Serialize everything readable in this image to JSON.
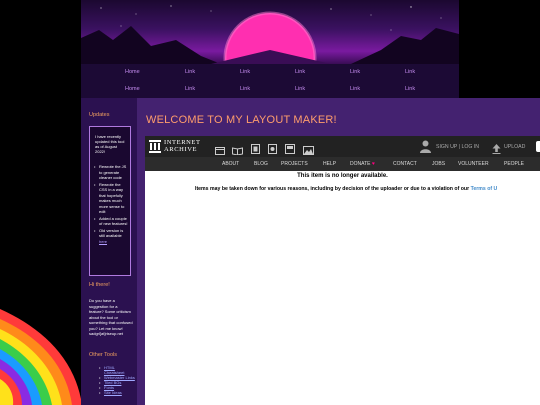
{
  "nav": {
    "row1": [
      "Home",
      "Link",
      "Link",
      "Link",
      "Link",
      "Link"
    ],
    "row2": [
      "Home",
      "Link",
      "Link",
      "Link",
      "Link",
      "Link"
    ]
  },
  "sidebar": {
    "updates_heading": "Updates",
    "notice": "I have recently updated this tool as of August 2022!",
    "bullets": [
      "Rewrote the JS to generate cleaner code",
      "Rewrote the CSS in a way that hopefully makes much more sense to edit",
      "Added a couple of new features!"
    ],
    "old_version_text": "Old version is still available ",
    "old_version_link": "here",
    "hi_heading": "Hi there!",
    "hi_text": "Do you have a suggestion for a feature? Some criticism about the tool or something that confused you? Let me know! sadgrl[at]riseup.net",
    "tools_heading": "Other Tools",
    "tools": [
      "HTML Cheatsheet",
      "Webmaster Links",
      "Tiled BGs",
      "Fonts",
      "Site Ideas"
    ]
  },
  "main": {
    "title": "WELCOME TO MY LAYOUT MAKER!"
  },
  "ia": {
    "logo_line1": "INTERNET",
    "logo_line2": "ARCHIVE",
    "signup": "SIGN UP | LOG IN",
    "upload": "UPLOAD",
    "menu": [
      "ABOUT",
      "BLOG",
      "PROJECTS",
      "HELP",
      "DONATE",
      "CONTACT",
      "JOBS",
      "VOLUNTEER",
      "PEOPLE"
    ],
    "message_title": "This item is no longer available.",
    "message_text": "Items may be taken down for various reasons, including by decision of the uploader or due to a violation of our ",
    "message_link": "Terms of U"
  },
  "colors": {
    "page_bg": "#000000",
    "banner_sun": "#ff2fb0",
    "nav_bg": "#1c0a35",
    "nav_link": "#c58cf0",
    "sidebar_bg": "#2b1150",
    "sidebar_heading": "#f0a060",
    "main_bg": "#442270",
    "main_title": "#ff9d6c",
    "ia_bar": "#222222",
    "ia_link": "#428bca",
    "donate_heart": "#ff0080"
  }
}
